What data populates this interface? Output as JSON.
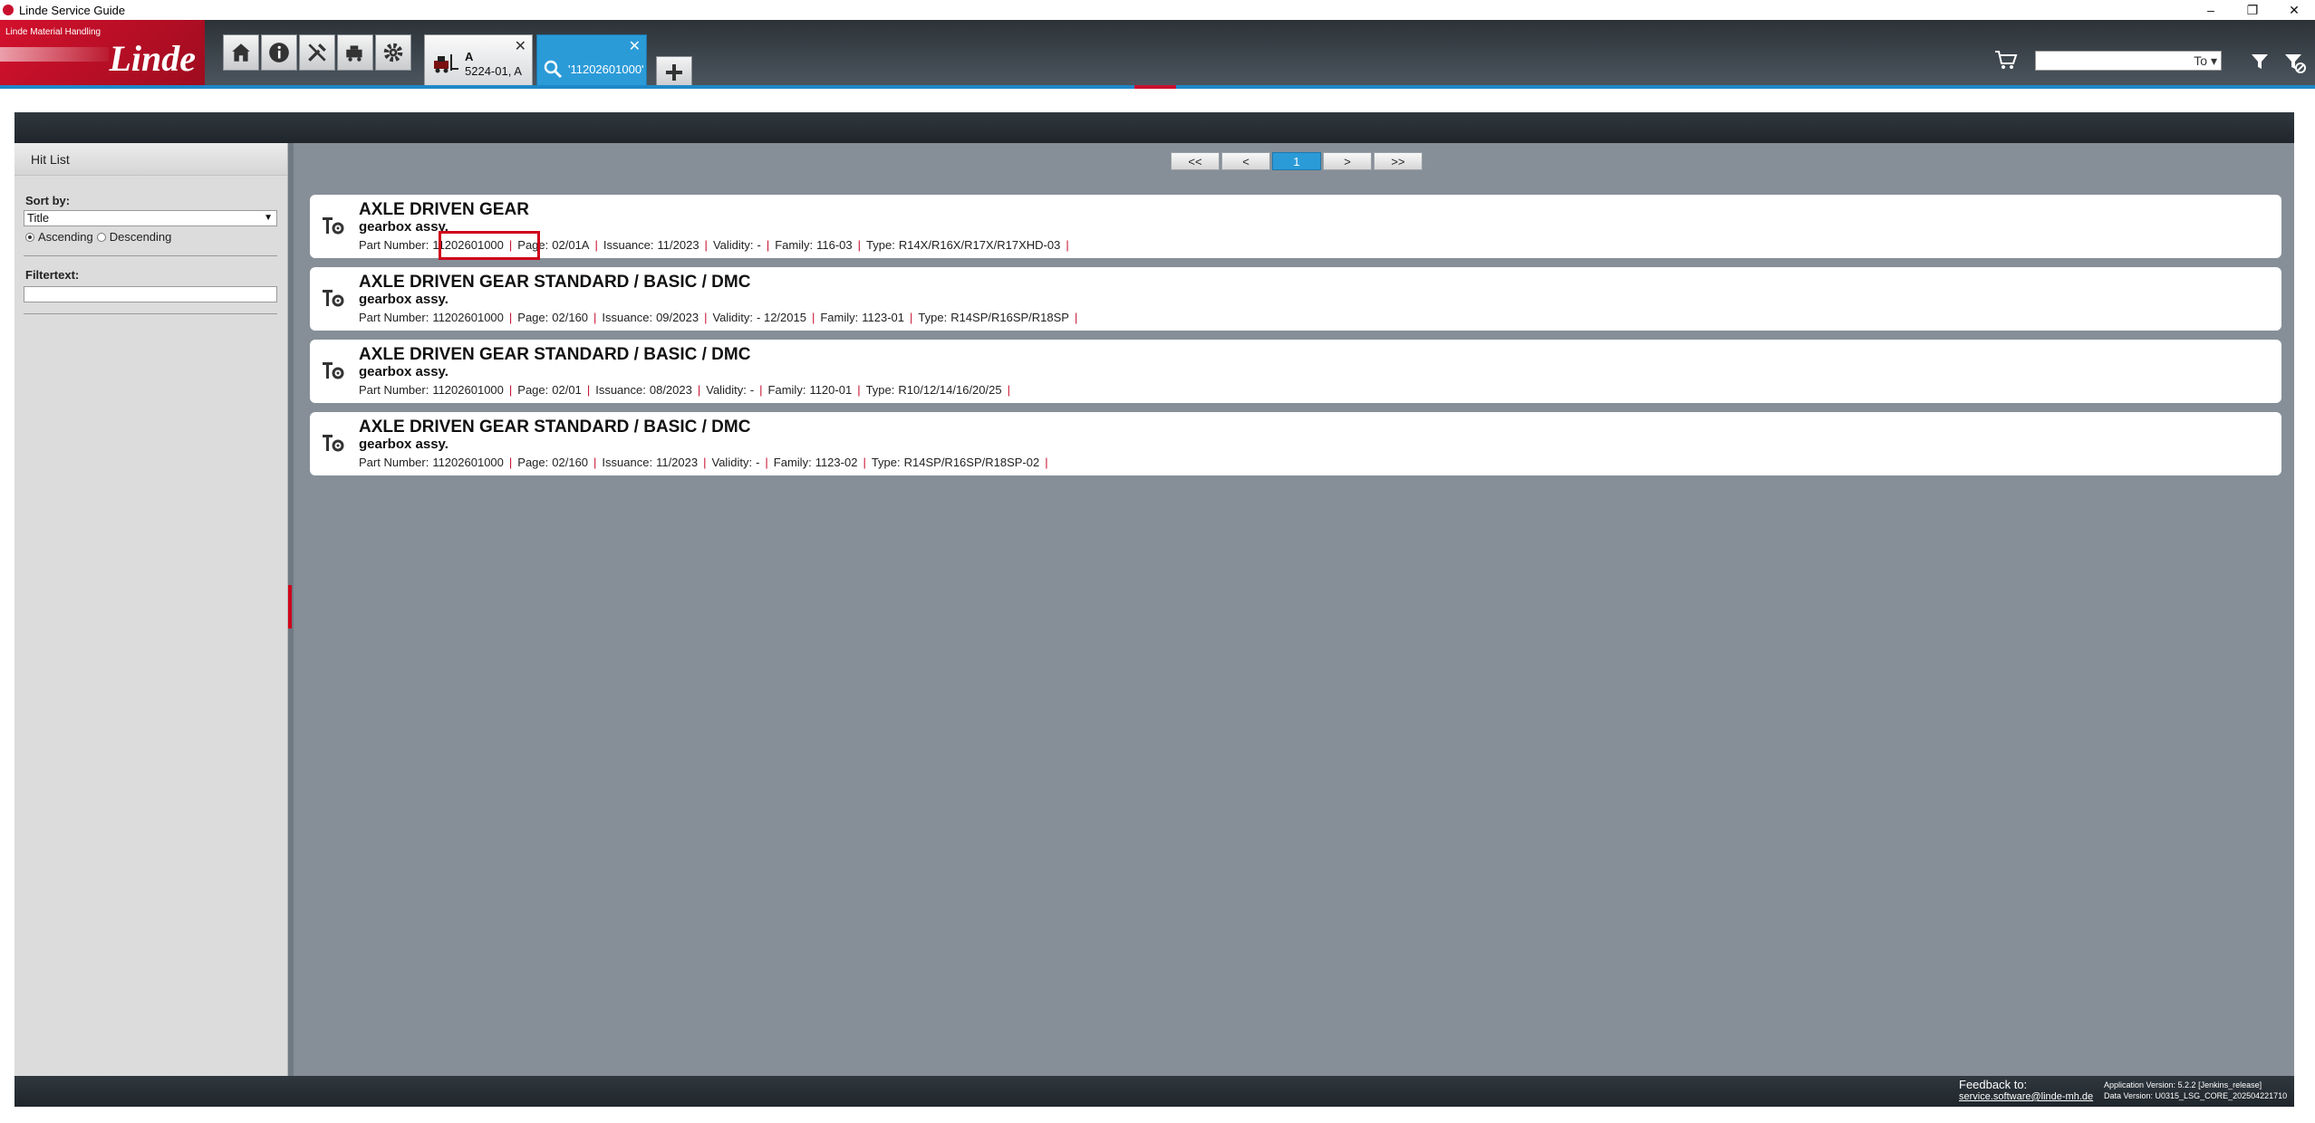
{
  "window": {
    "title": "Linde Service Guide"
  },
  "logo": {
    "subtitle": "Linde Material Handling",
    "brand": "Linde"
  },
  "tabs": [
    {
      "line1": "A",
      "line2": "5224-01, A"
    },
    {
      "label": "'11202601000'"
    }
  ],
  "search": {
    "value": "",
    "go_label": "To"
  },
  "sidebar": {
    "header": "Hit List",
    "sort_label": "Sort by:",
    "sort_value": "Title",
    "ascending": "Ascending",
    "descending": "Descending",
    "filter_label": "Filtertext:"
  },
  "pager": {
    "first": "<<",
    "prev": "<",
    "current": "1",
    "next": ">",
    "last": ">>"
  },
  "results": [
    {
      "title": "AXLE DRIVEN GEAR",
      "subtitle": "gearbox assy.",
      "part_number": "11202601000",
      "page": "02/01A",
      "issuance": "11/2023",
      "validity": "-",
      "family": "116-03",
      "type": "R14X/R16X/R17X/R17XHD-03"
    },
    {
      "title": "AXLE DRIVEN GEAR STANDARD / BASIC / DMC",
      "subtitle": "gearbox assy.",
      "part_number": "11202601000",
      "page": "02/160",
      "issuance": "09/2023",
      "validity": "- 12/2015",
      "family": "1123-01",
      "type": "R14SP/R16SP/R18SP"
    },
    {
      "title": "AXLE DRIVEN GEAR STANDARD / BASIC / DMC",
      "subtitle": "gearbox assy.",
      "part_number": "11202601000",
      "page": "02/01",
      "issuance": "08/2023",
      "validity": "-",
      "family": "1120-01",
      "type": "R10/12/14/16/20/25"
    },
    {
      "title": "AXLE DRIVEN GEAR STANDARD / BASIC / DMC",
      "subtitle": "gearbox assy.",
      "part_number": "11202601000",
      "page": "02/160",
      "issuance": "11/2023",
      "validity": "-",
      "family": "1123-02",
      "type": "R14SP/R16SP/R18SP-02"
    }
  ],
  "labels": {
    "part_number": "Part Number:",
    "page": "Page:",
    "issuance": "Issuance:",
    "validity": "Validity:",
    "family": "Family:",
    "type": "Type:"
  },
  "footer": {
    "feedback_title": "Feedback to:",
    "feedback_email": "service.software@linde-mh.de",
    "app_version": "Application Version: 5.2.2 [Jenkins_release]",
    "data_version": "Data Version: U0315_LSG_CORE_202504221710"
  },
  "colors": {
    "accent_blue": "#2b9bd8",
    "brand_red": "#c8102e",
    "main_bg": "#868f98"
  }
}
